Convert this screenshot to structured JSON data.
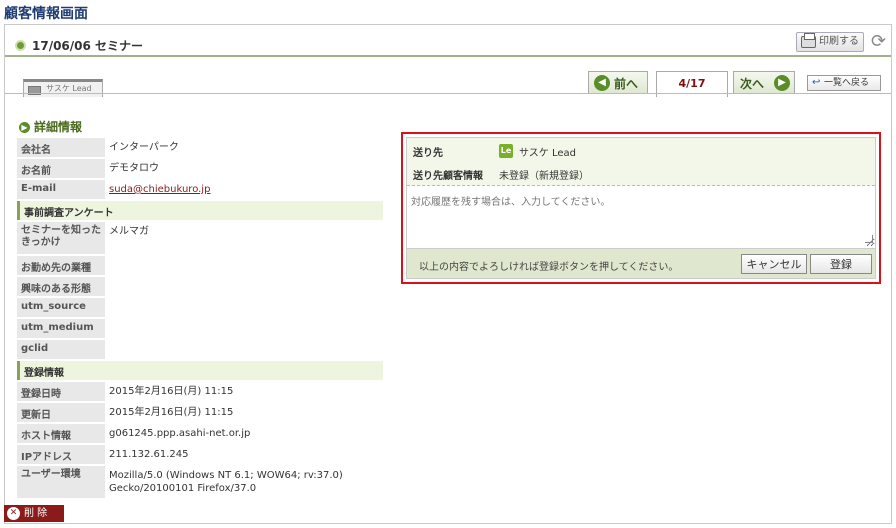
{
  "page_title": "顧客情報画面",
  "header": {
    "title": "17/06/06 セミナー",
    "print_label": "印刷する"
  },
  "tabs": {
    "lead_label": "サスケ Lead"
  },
  "navigation": {
    "prev_label": "前へ",
    "page_indicator": "4/17",
    "next_label": "次へ",
    "back_to_list_label": "一覧へ戻る"
  },
  "details": {
    "section_title": "詳細情報",
    "rows_basic": [
      {
        "key": "会社名",
        "value": "インターパーク"
      },
      {
        "key": "お名前",
        "value": "デモタロウ"
      }
    ],
    "email": {
      "key": "E-mail",
      "value": "suda@chiebukuro.jp"
    },
    "survey_group": "事前調査アンケート",
    "survey_rows": [
      {
        "key": "セミナーを知ったきっかけ",
        "value": "メルマガ"
      },
      {
        "key": "お勤め先の業種",
        "value": ""
      },
      {
        "key": "興味のある形態",
        "value": ""
      },
      {
        "key": "utm_source",
        "value": ""
      },
      {
        "key": "utm_medium",
        "value": ""
      },
      {
        "key": "gclid",
        "value": ""
      }
    ],
    "registration_group": "登録情報",
    "registration_rows": [
      {
        "key": "登録日時",
        "value": "2015年2月16日(月) 11:15"
      },
      {
        "key": "更新日",
        "value": "2015年2月16日(月) 11:15"
      },
      {
        "key": "ホスト情報",
        "value": "g061245.ppp.asahi-net.or.jp"
      },
      {
        "key": "IPアドレス",
        "value": "211.132.61.245"
      }
    ],
    "user_agent": {
      "key": "ユーザー環境",
      "value": "Mozilla/5.0 (Windows NT 6.1; WOW64; rv:37.0) Gecko/20100101 Firefox/37.0"
    }
  },
  "send_form": {
    "destination_key": "送り先",
    "destination_icon": "Le",
    "destination_value": "サスケ Lead",
    "customer_info_key": "送り先顧客情報",
    "customer_info_value": "未登録（新規登録）",
    "textarea_placeholder": "対応履歴を残す場合は、入力してください。",
    "footer_message": "以上の内容でよろしければ登録ボタンを押してください。",
    "cancel_label": "キャンセル",
    "submit_label": "登録"
  },
  "delete_label": "削 除"
}
